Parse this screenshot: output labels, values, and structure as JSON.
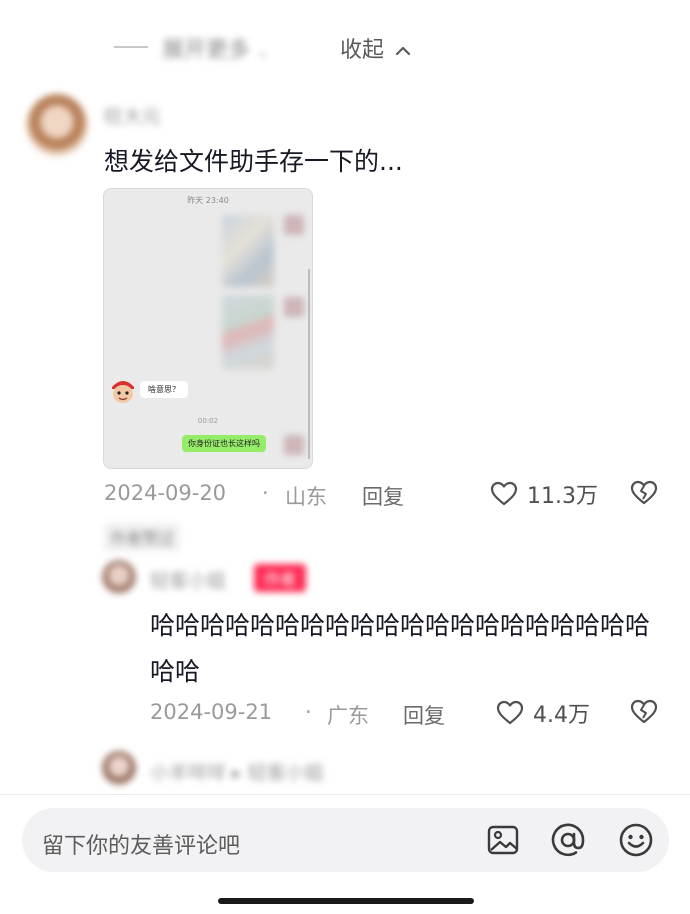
{
  "top_bar": {
    "expand_more_label": "展开更多",
    "collapse_label": "收起"
  },
  "comment": {
    "username": "旺大元",
    "text": "想发给文件助手存一下的...",
    "screenshot": {
      "time_header": "昨天 23:40",
      "message_1": "啥意思？",
      "voice_time": "00:02",
      "message_2": "你身份证也长这样吗"
    },
    "date": "2024-09-20",
    "location": "山东",
    "reply_label": "回复",
    "likes": "11.3万",
    "author_liked_tag": "作者赞过"
  },
  "reply": {
    "username": "轻客小姐",
    "badge": "作者",
    "text": "哈哈哈哈哈哈哈哈哈哈哈哈哈哈哈哈哈哈哈哈哈哈",
    "date": "2024-09-21",
    "location": "广东",
    "reply_label": "回复",
    "likes": "4.4万"
  },
  "next_reply": {
    "username": "小羊咩咩 ▸ 轻客小姐"
  },
  "composer": {
    "placeholder": "留下你的友善评论吧"
  }
}
